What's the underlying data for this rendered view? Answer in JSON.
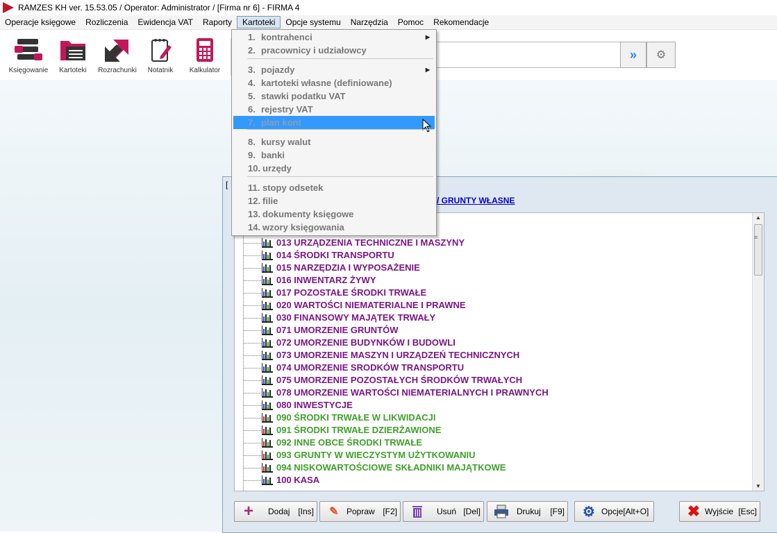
{
  "window_title": "RAMZES KH ver. 15.53.05 /  Operator: Administrator /   [Firma nr 6] - FIRMA 4",
  "menubar": [
    "Operacje księgowe",
    "Rozliczenia",
    "Ewidencja VAT",
    "Raporty",
    "Kartoteki",
    "Opcje systemu",
    "Narzędzia",
    "Pomoc",
    "Rekomendacje"
  ],
  "toolbar": [
    {
      "label": "Księgowanie",
      "icon": "ledger-icon"
    },
    {
      "label": "Kartoteki",
      "icon": "folder-icon"
    },
    {
      "label": "Rozrachunki",
      "icon": "exchange-arrows-icon"
    },
    {
      "label": "Notatnik",
      "icon": "notepad-icon"
    },
    {
      "label": "Kalkulator",
      "icon": "calculator-icon"
    }
  ],
  "search": {
    "value": "",
    "go_icon": "double-arrow-icon",
    "settings_icon": "gears-icon"
  },
  "dropdown": [
    {
      "num": "1.",
      "label": "kontrahenci",
      "arrow": true
    },
    {
      "num": "2.",
      "label": "pracownicy i udziałowcy",
      "arrow": false
    },
    {
      "num": "3.",
      "label": "pojazdy",
      "arrow": true
    },
    {
      "num": "4.",
      "label": "kartoteki własne (definiowane)",
      "arrow": false
    },
    {
      "num": "5.",
      "label": "stawki podatku VAT",
      "arrow": false
    },
    {
      "num": "6.",
      "label": "rejestry VAT",
      "arrow": false
    },
    {
      "num": "7.",
      "label": "plan kont",
      "arrow": false,
      "highlighted": true
    },
    {
      "num": "8.",
      "label": "kursy walut",
      "arrow": false
    },
    {
      "num": "9.",
      "label": "banki",
      "arrow": false
    },
    {
      "num": "10.",
      "label": "urzędy",
      "arrow": false
    },
    {
      "num": "11.",
      "label": "stopy odsetek",
      "arrow": false
    },
    {
      "num": "12.",
      "label": "filie",
      "arrow": false
    },
    {
      "num": "13.",
      "label": "dokumenty księgowe",
      "arrow": false
    },
    {
      "num": "14.",
      "label": "wzory księgowania",
      "arrow": false
    }
  ],
  "inner_window": {
    "title": "[",
    "breadcrumb": "1 / GRUNTY WŁASNE"
  },
  "accounts": [
    {
      "text": "013 URZĄDZENIA TECHNICZNE I MASZYNY",
      "color": "#7b1587"
    },
    {
      "text": "014 ŚRODKI TRANSPORTU",
      "color": "#7b1587"
    },
    {
      "text": "015 NARZĘDZIA I WYPOSAŻENIE",
      "color": "#7b1587"
    },
    {
      "text": "016 INWENTARZ ŻYWY",
      "color": "#7b1587"
    },
    {
      "text": "017 POZOSTAŁE ŚRODKI TRWAŁE",
      "color": "#7b1587"
    },
    {
      "text": "020 WARTOŚCI NIEMATERIALNE I PRAWNE",
      "color": "#7b1587"
    },
    {
      "text": "030 FINANSOWY MAJĄTEK TRWAŁY",
      "color": "#7b1587"
    },
    {
      "text": "071 UMORZENIE GRUNTÓW",
      "color": "#7b1587"
    },
    {
      "text": "072 UMORZENIE BUDYNKÓW I BUDOWLI",
      "color": "#7b1587"
    },
    {
      "text": "073 UMORZENIE MASZYN I URZĄDZEŃ TECHNICZNYCH",
      "color": "#7b1587"
    },
    {
      "text": "074 UMORZENIE SRODKÓW TRANSPORTU",
      "color": "#7b1587"
    },
    {
      "text": "075 UMORZENIE POZOSTAŁYCH ŚRODKÓW TRWAŁYCH",
      "color": "#7b1587"
    },
    {
      "text": "078 UMORZENIE WARTOŚCI NIEMATERIALNYCH I PRAWNYCH",
      "color": "#7b1587"
    },
    {
      "text": "080 INWESTYCJE",
      "color": "#7b1587"
    },
    {
      "text": "090 ŚRODKI TRWAŁE W LIKWIDACJI",
      "color": "#3fa02a"
    },
    {
      "text": "091 ŚRODKI TRWAŁE DZIERŻAWIONE",
      "color": "#3fa02a"
    },
    {
      "text": "092 INNE OBCE ŚRODKI TRWAŁE",
      "color": "#3fa02a"
    },
    {
      "text": "093 GRUNTY W WIECZYSTYM UŻYTKOWANIU",
      "color": "#3fa02a"
    },
    {
      "text": "094 NISKOWARTOŚCIOWE SKŁADNIKI MAJĄTKOWE",
      "color": "#3fa02a"
    },
    {
      "text": "100 KASA",
      "color": "#7b1587"
    }
  ],
  "buttons": [
    {
      "label": "Dodaj",
      "key": "[Ins]",
      "icon": "plus-icon"
    },
    {
      "label": "Popraw",
      "key": "[F2]",
      "icon": "pencil-icon"
    },
    {
      "label": "Usuń",
      "key": "[Del]",
      "icon": "trash-icon"
    },
    {
      "label": "Drukuj",
      "key": "[F9]",
      "icon": "printer-icon"
    },
    {
      "label": "Opcje[Alt+O]",
      "key": "",
      "icon": "gear-icon"
    },
    {
      "label": "Wyjście",
      "key": "[Esc]",
      "icon": "close-icon"
    }
  ]
}
